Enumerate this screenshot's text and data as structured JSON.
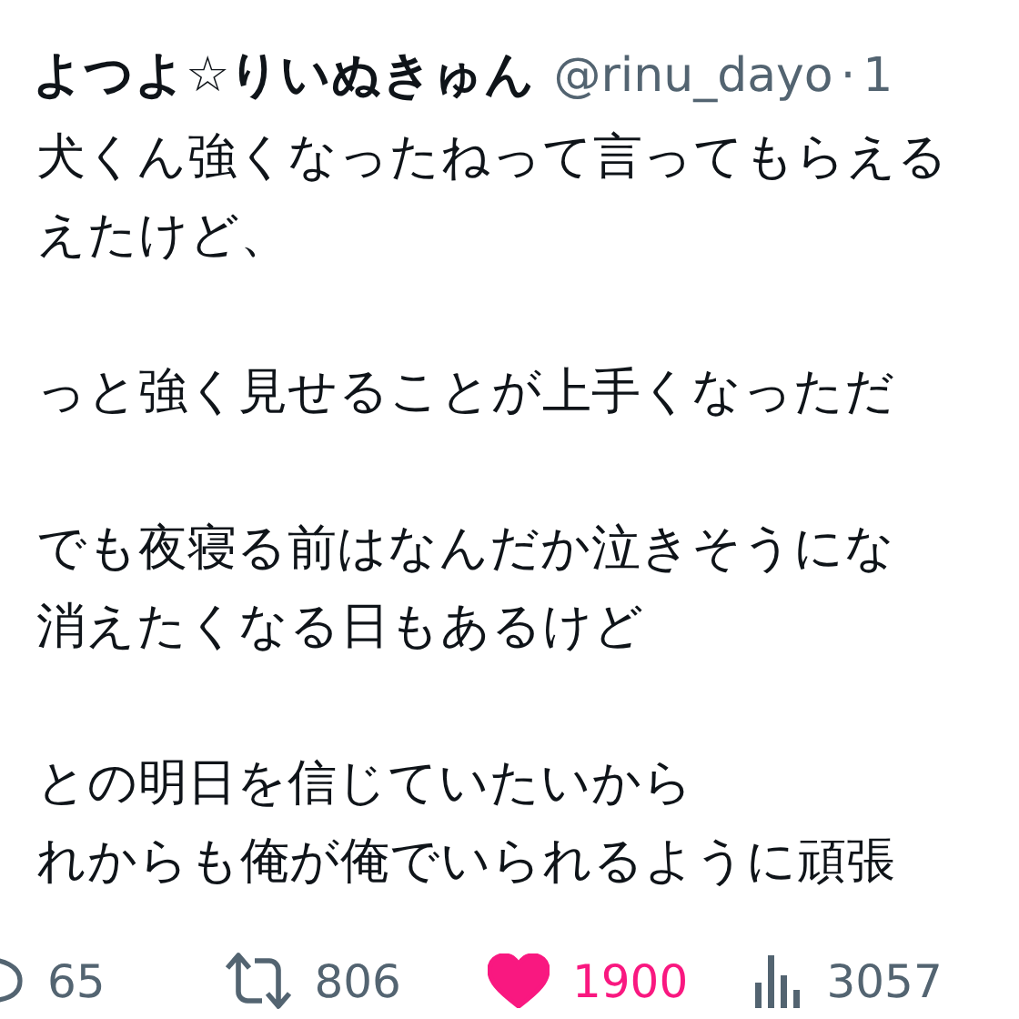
{
  "author": {
    "name": "よつよ☆りいぬきゅん",
    "handle": "@rinu_dayo",
    "separator": "·",
    "time": "1"
  },
  "paragraphs": [
    {
      "lines": [
        "犬くん強くなったねって言ってもらえる",
        "えたけど、"
      ]
    },
    {
      "lines": [
        "っと強く見せることが上手くなっただ"
      ]
    },
    {
      "lines": [
        "でも夜寝る前はなんだか泣きそうにな",
        "消えたくなる日もあるけど"
      ]
    },
    {
      "lines": [
        "との明日を信じていたいから",
        "れからも俺が俺でいられるように頑張"
      ]
    }
  ],
  "actions": [
    {
      "kind": "reply",
      "count": "65"
    },
    {
      "kind": "retweet",
      "count": "806"
    },
    {
      "kind": "like",
      "count": "1900",
      "selected": true
    },
    {
      "kind": "views",
      "count": "3057"
    }
  ]
}
